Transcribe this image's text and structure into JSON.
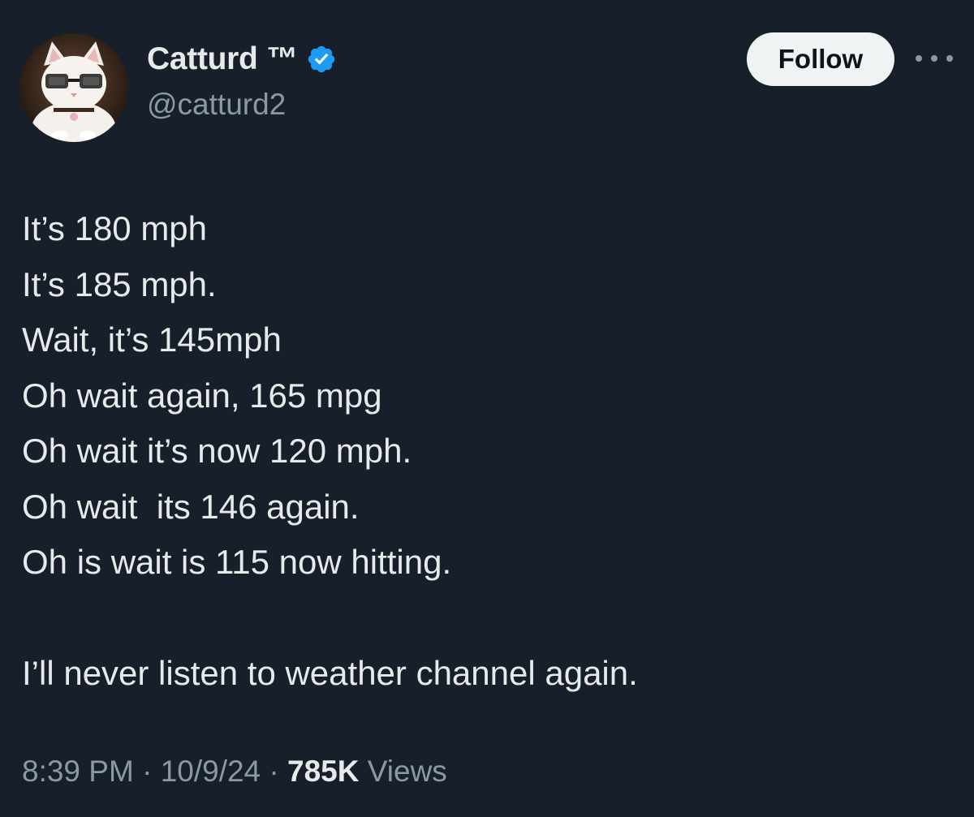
{
  "author": {
    "display_name": "Catturd ™",
    "handle": "@catturd2",
    "verified": true,
    "verified_color": "#1d9bf0"
  },
  "actions": {
    "follow_label": "Follow",
    "more_icon": "more-horizontal-icon"
  },
  "tweet": {
    "lines": [
      "It’s 180 mph",
      "It’s 185 mph.",
      "Wait, it’s 145mph",
      "Oh wait again, 165 mpg",
      "Oh wait it’s now 120 mph.",
      "Oh wait  its 146 again.",
      "Oh is wait is 115 now hitting.",
      "",
      "I’ll never listen to weather channel again."
    ]
  },
  "meta": {
    "time": "8:39 PM",
    "separator": "·",
    "date": "10/9/24",
    "views_count": "785K",
    "views_label": "Views"
  }
}
